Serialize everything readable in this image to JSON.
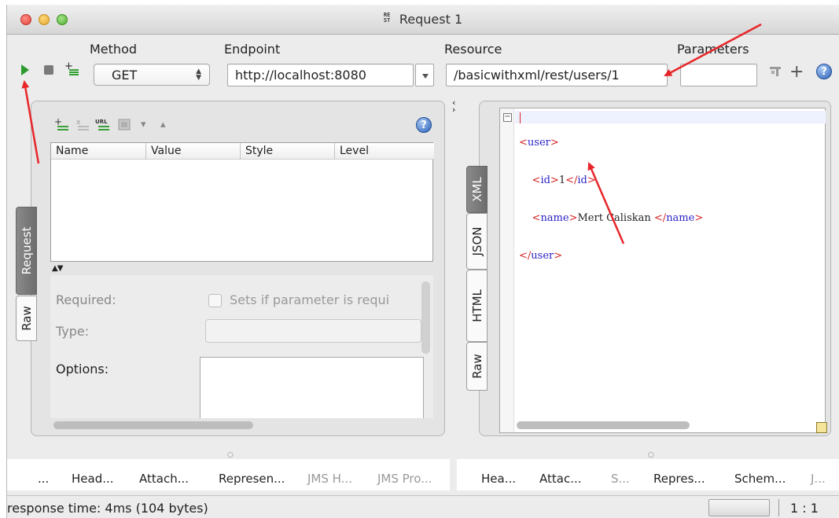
{
  "window": {
    "title": "Request 1",
    "title_icon_text": "RE\nST"
  },
  "toolbar": {
    "method_label": "Method",
    "method_value": "GET",
    "endpoint_label": "Endpoint",
    "endpoint_value": "http://localhost:8080",
    "resource_label": "Resource",
    "resource_value": "/basicwithxml/rest/users/1",
    "parameters_label": "Parameters",
    "parameters_value": ""
  },
  "request_panel": {
    "tabs": [
      "Request",
      "Raw"
    ],
    "table_columns": [
      "Name",
      "Value",
      "Style",
      "Level"
    ],
    "details": {
      "required_label": "Required:",
      "sets_if_label": "Sets if parameter is requi",
      "type_label": "Type:",
      "options_label": "Options:"
    }
  },
  "response_panel": {
    "tabs": [
      "XML",
      "JSON",
      "HTML",
      "Raw"
    ],
    "xml_lines": [
      {
        "open": "user",
        "text": "",
        "close": ""
      },
      {
        "open": "id",
        "text": "1",
        "close": "id"
      },
      {
        "open": "name",
        "text": "Mert Caliskan ",
        "close": "name"
      },
      {
        "open": "",
        "text": "",
        "close": "user"
      }
    ]
  },
  "bottom_tabs_left": [
    "...",
    "Head...",
    "Attach...",
    "Represen...",
    "JMS H...",
    "JMS Pro..."
  ],
  "bottom_tabs_right": [
    "Hea...",
    "Attac...",
    "S...",
    "Repres...",
    "Schem...",
    "J..."
  ],
  "status": {
    "text": "response time: 4ms (104 bytes)",
    "position": "1 : 1"
  },
  "colors": {
    "annotation_arrow": "#e8262a",
    "run_button": "#2e9a2e",
    "xml_tag": "#2a22c6",
    "xml_bracket": "#d42020"
  }
}
